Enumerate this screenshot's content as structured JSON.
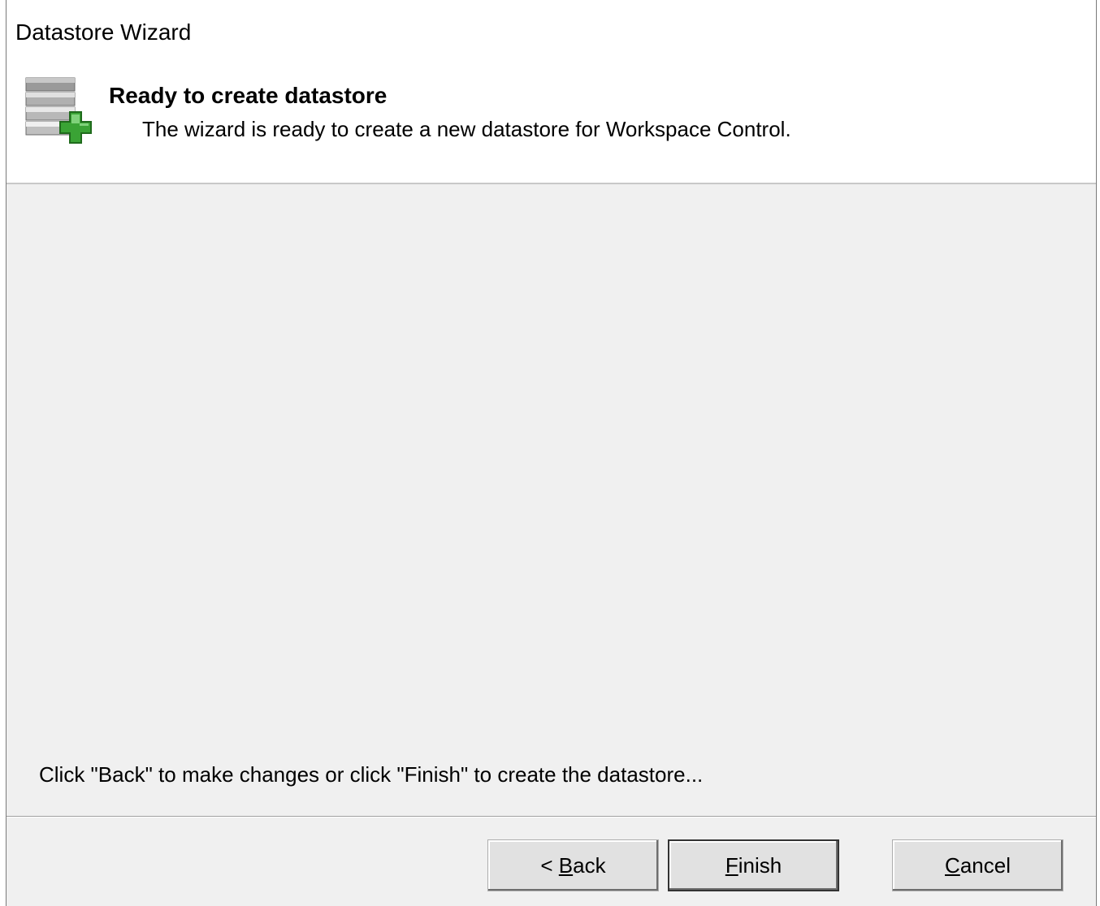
{
  "window": {
    "title": "Datastore Wizard"
  },
  "header": {
    "icon": "database-add-icon",
    "title": "Ready to create datastore",
    "subtitle": "The wizard is ready to create a new datastore for Workspace Control."
  },
  "content": {
    "hint": "Click \"Back\" to make changes or click \"Finish\" to create the datastore..."
  },
  "buttons": {
    "back": {
      "prefix": "< ",
      "mnemonic": "B",
      "rest": "ack"
    },
    "finish": {
      "prefix": "",
      "mnemonic": "F",
      "rest": "inish"
    },
    "cancel": {
      "prefix": "",
      "mnemonic": "C",
      "rest": "ancel"
    }
  },
  "colors": {
    "dialog_bg": "#f0f0f0",
    "header_bg": "#ffffff",
    "icon_plus": "#3aa335"
  }
}
